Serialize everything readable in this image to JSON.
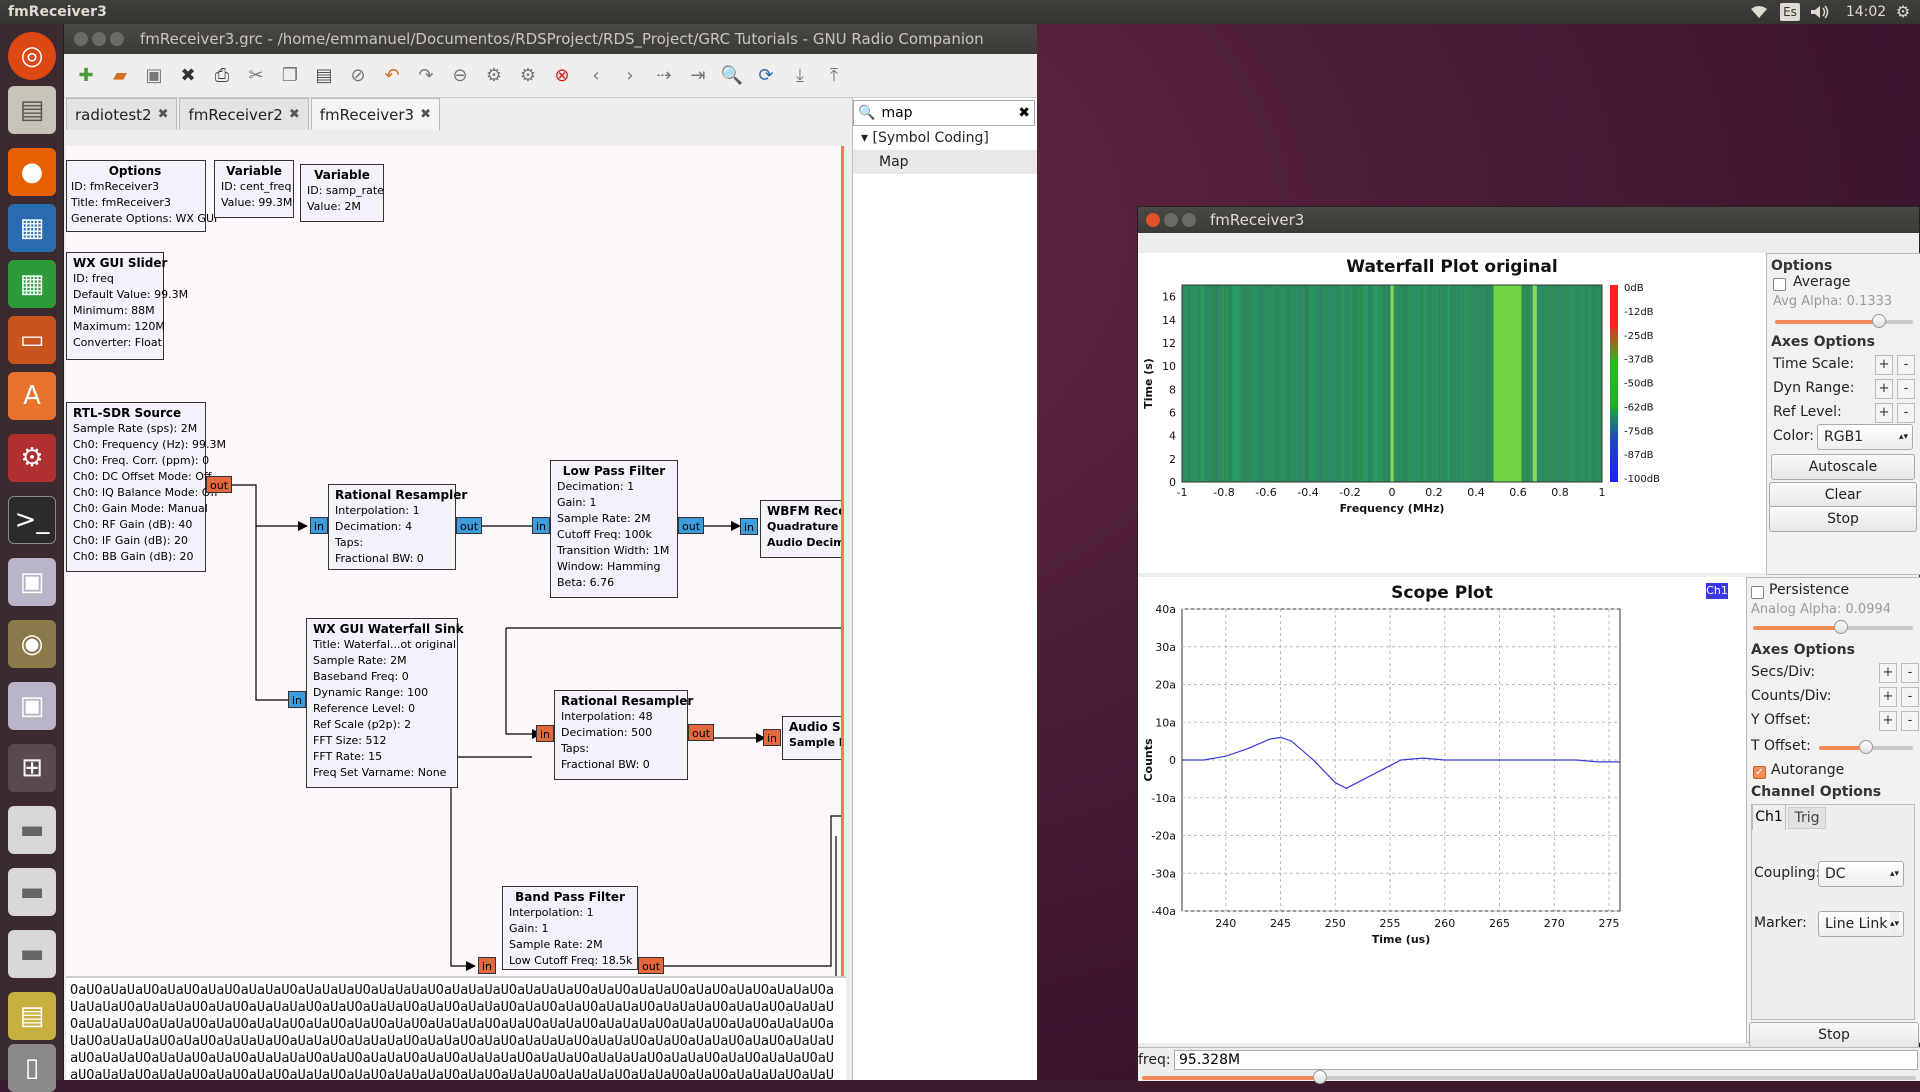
{
  "top_panel": {
    "app_title": "fmReceiver3",
    "keyboard_layout": "Es",
    "clock": "14:02"
  },
  "grc_window": {
    "title": "fmReceiver3.grc - /home/emmanuel/Documentos/RDSProject/RDS_Project/GRC Tutorials - GNU Radio Companion",
    "tabs": [
      "radiotest2",
      "fmReceiver2",
      "fmReceiver3"
    ],
    "active_tab": "fmReceiver3",
    "search_value": "map",
    "tree": {
      "category": "[Symbol Coding]",
      "item": "Map"
    },
    "blocks": {
      "options": {
        "title": "Options",
        "lines": [
          "ID: fmReceiver3",
          "Title: fmReceiver3",
          "Generate Options: WX GUI"
        ]
      },
      "var_freq": {
        "title": "Variable",
        "lines": [
          "ID: cent_freq",
          "Value: 99.3M"
        ]
      },
      "var_samp": {
        "title": "Variable",
        "lines": [
          "ID: samp_rate",
          "Value: 2M"
        ]
      },
      "slider": {
        "title": "WX GUI Slider",
        "lines": [
          "ID: freq",
          "Default Value: 99.3M",
          "Minimum: 88M",
          "Maximum: 120M",
          "Converter: Float"
        ]
      },
      "rtl": {
        "title": "RTL-SDR Source",
        "lines": [
          "Sample Rate (sps): 2M",
          "Ch0: Frequency (Hz): 99.3M",
          "Ch0: Freq. Corr. (ppm): 0",
          "Ch0: DC Offset Mode: Off",
          "Ch0: IQ Balance Mode: Off",
          "Ch0: Gain Mode: Manual",
          "Ch0: RF Gain (dB): 40",
          "Ch0: IF Gain (dB): 20",
          "Ch0: BB Gain (dB): 20"
        ]
      },
      "resampler1": {
        "title": "Rational Resampler",
        "lines": [
          "Interpolation: 1",
          "Decimation: 4",
          "Taps:",
          "Fractional BW: 0"
        ]
      },
      "lpf": {
        "title": "Low Pass Filter",
        "lines": [
          "Decimation: 1",
          "Gain: 1",
          "Sample Rate: 2M",
          "Cutoff Freq: 100k",
          "Transition Width: 1M",
          "Window: Hamming",
          "Beta: 6.76"
        ]
      },
      "wbfm": {
        "title": "WBFM Receive",
        "lines": [
          "Quadrature Rate",
          "Audio Decimation"
        ]
      },
      "waterfall": {
        "title": "WX GUI Waterfall Sink",
        "lines": [
          "Title: Waterfal...ot original",
          "Sample Rate: 2M",
          "Baseband Freq: 0",
          "Dynamic Range: 100",
          "Reference Level: 0",
          "Ref Scale (p2p): 2",
          "FFT Size: 512",
          "FFT Rate: 15",
          "Freq Set Varname: None"
        ]
      },
      "resampler2": {
        "title": "Rational Resampler",
        "lines": [
          "Interpolation: 48",
          "Decimation: 500",
          "Taps:",
          "Fractional BW: 0"
        ]
      },
      "audio": {
        "title": "Audio Sink",
        "lines": [
          "Sample Rate"
        ]
      },
      "bpf": {
        "title": "Band Pass Filter",
        "lines": [
          "Interpolation: 1",
          "Gain: 1",
          "Sample Rate: 2M",
          "Low Cutoff Freq: 18.5k"
        ]
      }
    },
    "port_in": "in",
    "port_out": "out",
    "console_text": "OaUOaUaUaUOaUaUOaUaUOaUaUaUOaUaUaUaUOaUaUaUaUOaUaUaUaUOaUaUaUaUOaUaUOaUaUaUOaUaUOaUaUOaUaUaUOaUaUaUaUOaUaUaUaUOaUaUOaUaUaUaUOaUaUOaUaUaUOaUaUOaUaUaUOaUaUOaUaUOaUaUaUOaUaUaUaUOaUaUaUOaUaUaUOaUaUaUaUOaUaUaUOaUaUOaUaUaUOaUaUOaUaUOaUaUOaUaUaUaUOaUaUOaUaUaUOaUaUaUaUOaUaUaUOaUaUOaUaUaUOaUaUOaUaUaUaUOaUaUOaUaUaUaUOaUaUaUOaUaUaUaUOaUaUaUOaUaUOaUaUaUaUOaUaUaUOaUaUOaUaUaUOaUaUOaUaUaUaUOaUaUaUOaUaUaUOaUaUOaUaUaUaUOaUaUOaUaUaUOaUaUOaUaUaUaUOaUaUaUOaUaUaUaUOaUaUaUOaUaUOaUaUaUOaUaUOaUaUaUOaUaUaUOaUaUOaUaUOaUaUaUOaUaUOaUaUaUaUOaUaUOaUaUaUOaUaUaUaUOaUaUaUOaUaUOaUaUaUaUOaUaUaUOaUaUaUOaUaU"
  },
  "fm_window": {
    "title": "fmReceiver3",
    "waterfall": {
      "title": "Waterfall Plot original",
      "y_label": "Time (s)",
      "x_label": "Frequency (MHz)",
      "y_ticks": [
        "16",
        "14",
        "12",
        "10",
        "8",
        "6",
        "4",
        "2",
        "0"
      ],
      "x_ticks": [
        "-1",
        "-0.8",
        "-0.6",
        "-0.4",
        "-0.2",
        "0",
        "0.2",
        "0.4",
        "0.6",
        "0.8",
        "1"
      ],
      "db_ticks": [
        "0dB",
        "-12dB",
        "-25dB",
        "-37dB",
        "-50dB",
        "-62dB",
        "-75dB",
        "-87dB",
        "-100dB"
      ]
    },
    "wf_controls": {
      "options": "Options",
      "average": "Average",
      "avg_alpha": "Avg Alpha: 0.1333",
      "avg_alpha_value": 0.75,
      "axes": "Axes Options",
      "time_scale": "Time Scale:",
      "dyn_range": "Dyn Range:",
      "ref_level": "Ref Level:",
      "color": "Color:",
      "color_value": "RGB1",
      "autoscale": "Autoscale",
      "clear": "Clear",
      "stop": "Stop",
      "plus": "+",
      "minus": "-"
    },
    "scope": {
      "title": "Scope Plot",
      "channel_badge": "Ch1",
      "y_label": "Counts",
      "x_label": "Time (us)",
      "y_ticks": [
        "40a",
        "30a",
        "20a",
        "10a",
        "0",
        "-10a",
        "-20a",
        "-30a",
        "-40a"
      ],
      "x_ticks": [
        "240",
        "245",
        "250",
        "255",
        "260",
        "265",
        "270",
        "275"
      ]
    },
    "scope_controls": {
      "persistence": "Persistence",
      "analog_alpha": "Analog Alpha: 0.0994",
      "analog_alpha_value": 0.55,
      "axes": "Axes Options",
      "secs_div": "Secs/Div:",
      "counts_div": "Counts/Div:",
      "y_offset": "Y Offset:",
      "t_offset": "T Offset:",
      "t_offset_value": 0.5,
      "autorange": "Autorange",
      "channel_options": "Channel Options",
      "tab_ch1": "Ch1",
      "tab_trig": "Trig",
      "coupling": "Coupling:",
      "coupling_value": "DC",
      "marker": "Marker:",
      "marker_value": "Line Link",
      "stop": "Stop"
    },
    "freq_label": "freq:",
    "freq_value": "95.328M",
    "freq_slider_value": 0.23
  },
  "chart_data": [
    {
      "type": "heatmap",
      "title": "Waterfall Plot original",
      "xlabel": "Frequency (MHz)",
      "ylabel": "Time (s)",
      "xlim": [
        -1,
        1
      ],
      "ylim": [
        0,
        17
      ],
      "colorbar": {
        "min": "-100dB",
        "max": "0dB"
      },
      "bright_bands_x": [
        0.0,
        0.55,
        0.68
      ]
    },
    {
      "type": "line",
      "title": "Scope Plot",
      "xlabel": "Time (us)",
      "ylabel": "Counts",
      "xlim": [
        236,
        276
      ],
      "ylim": [
        -40,
        40
      ],
      "series": [
        {
          "name": "Ch1",
          "x": [
            236,
            238,
            240,
            242,
            244,
            245,
            246,
            248,
            250,
            251,
            252,
            254,
            256,
            258,
            260,
            262,
            264,
            266,
            268,
            270,
            272,
            274,
            276
          ],
          "y": [
            0,
            0,
            1,
            3,
            5.5,
            6,
            5,
            0,
            -6,
            -7.5,
            -6,
            -3,
            0,
            0.5,
            0,
            0,
            0,
            0,
            0,
            0,
            0,
            -0.5,
            -0.5
          ]
        }
      ]
    }
  ]
}
